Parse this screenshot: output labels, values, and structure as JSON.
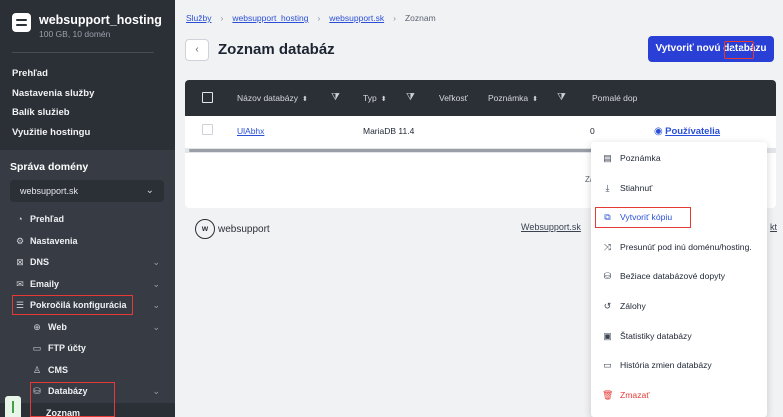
{
  "sidebar": {
    "brand": {
      "name": "websupport_hosting",
      "sub": "100 GB, 10 domén"
    },
    "top_nav": [
      "Prehľad",
      "Nastavenia služby",
      "Balík služieb",
      "Využitie hostingu"
    ],
    "domain_title": "Správa domény",
    "domain_select": "websupport.sk",
    "nav": {
      "prehlad": "Prehľad",
      "nastavenia": "Nastavenia",
      "dns": "DNS",
      "emaily": "Emaily",
      "pokrocila": "Pokročilá konfigurácia",
      "web": "Web",
      "ftp": "FTP účty",
      "cms": "CMS",
      "databazy": "Databázy",
      "zoznam": "Zoznam"
    }
  },
  "breadcrumb": {
    "b1": "Služby",
    "b2": "websupport_hosting",
    "b3": "websupport.sk",
    "b4": "Zoznam"
  },
  "page": {
    "title": "Zoznam databáz",
    "create_button": "Vytvoriť novú databázu"
  },
  "table": {
    "columns": {
      "name": "Názov databázy",
      "type": "Typ",
      "size": "Veľkosť",
      "note": "Poznámka",
      "slow": "Pomalé dop"
    },
    "row": {
      "name": "UlAbhx",
      "type": "MariaDB 11.4",
      "slow": "0",
      "users": "Používatelia"
    },
    "pager_fragment": "Zázr"
  },
  "footer": {
    "logo_text": "websupport",
    "link": "Websupport.sk",
    "link2": "kt"
  },
  "menu": {
    "items": [
      {
        "label": "Poznámka",
        "icon": "note-icon"
      },
      {
        "label": "Stiahnuť",
        "icon": "download-icon"
      },
      {
        "label": "Vytvoriť kópiu",
        "icon": "copy-icon"
      },
      {
        "label": "Presunúť pod inú doménu/hosting.",
        "icon": "shuffle-icon"
      },
      {
        "label": "Bežiace databázové dopyty",
        "icon": "database-icon"
      },
      {
        "label": "Zálohy",
        "icon": "history-icon"
      },
      {
        "label": "Štatistiky databázy",
        "icon": "stats-icon"
      },
      {
        "label": "História zmien databázy",
        "icon": "archive-icon"
      },
      {
        "label": "Zmazať",
        "icon": "trash-icon"
      }
    ]
  },
  "colors": {
    "primary": "#2a3fd6",
    "link": "#2a4fd6",
    "sidebar": "#2b2f36",
    "danger": "#e53935"
  }
}
